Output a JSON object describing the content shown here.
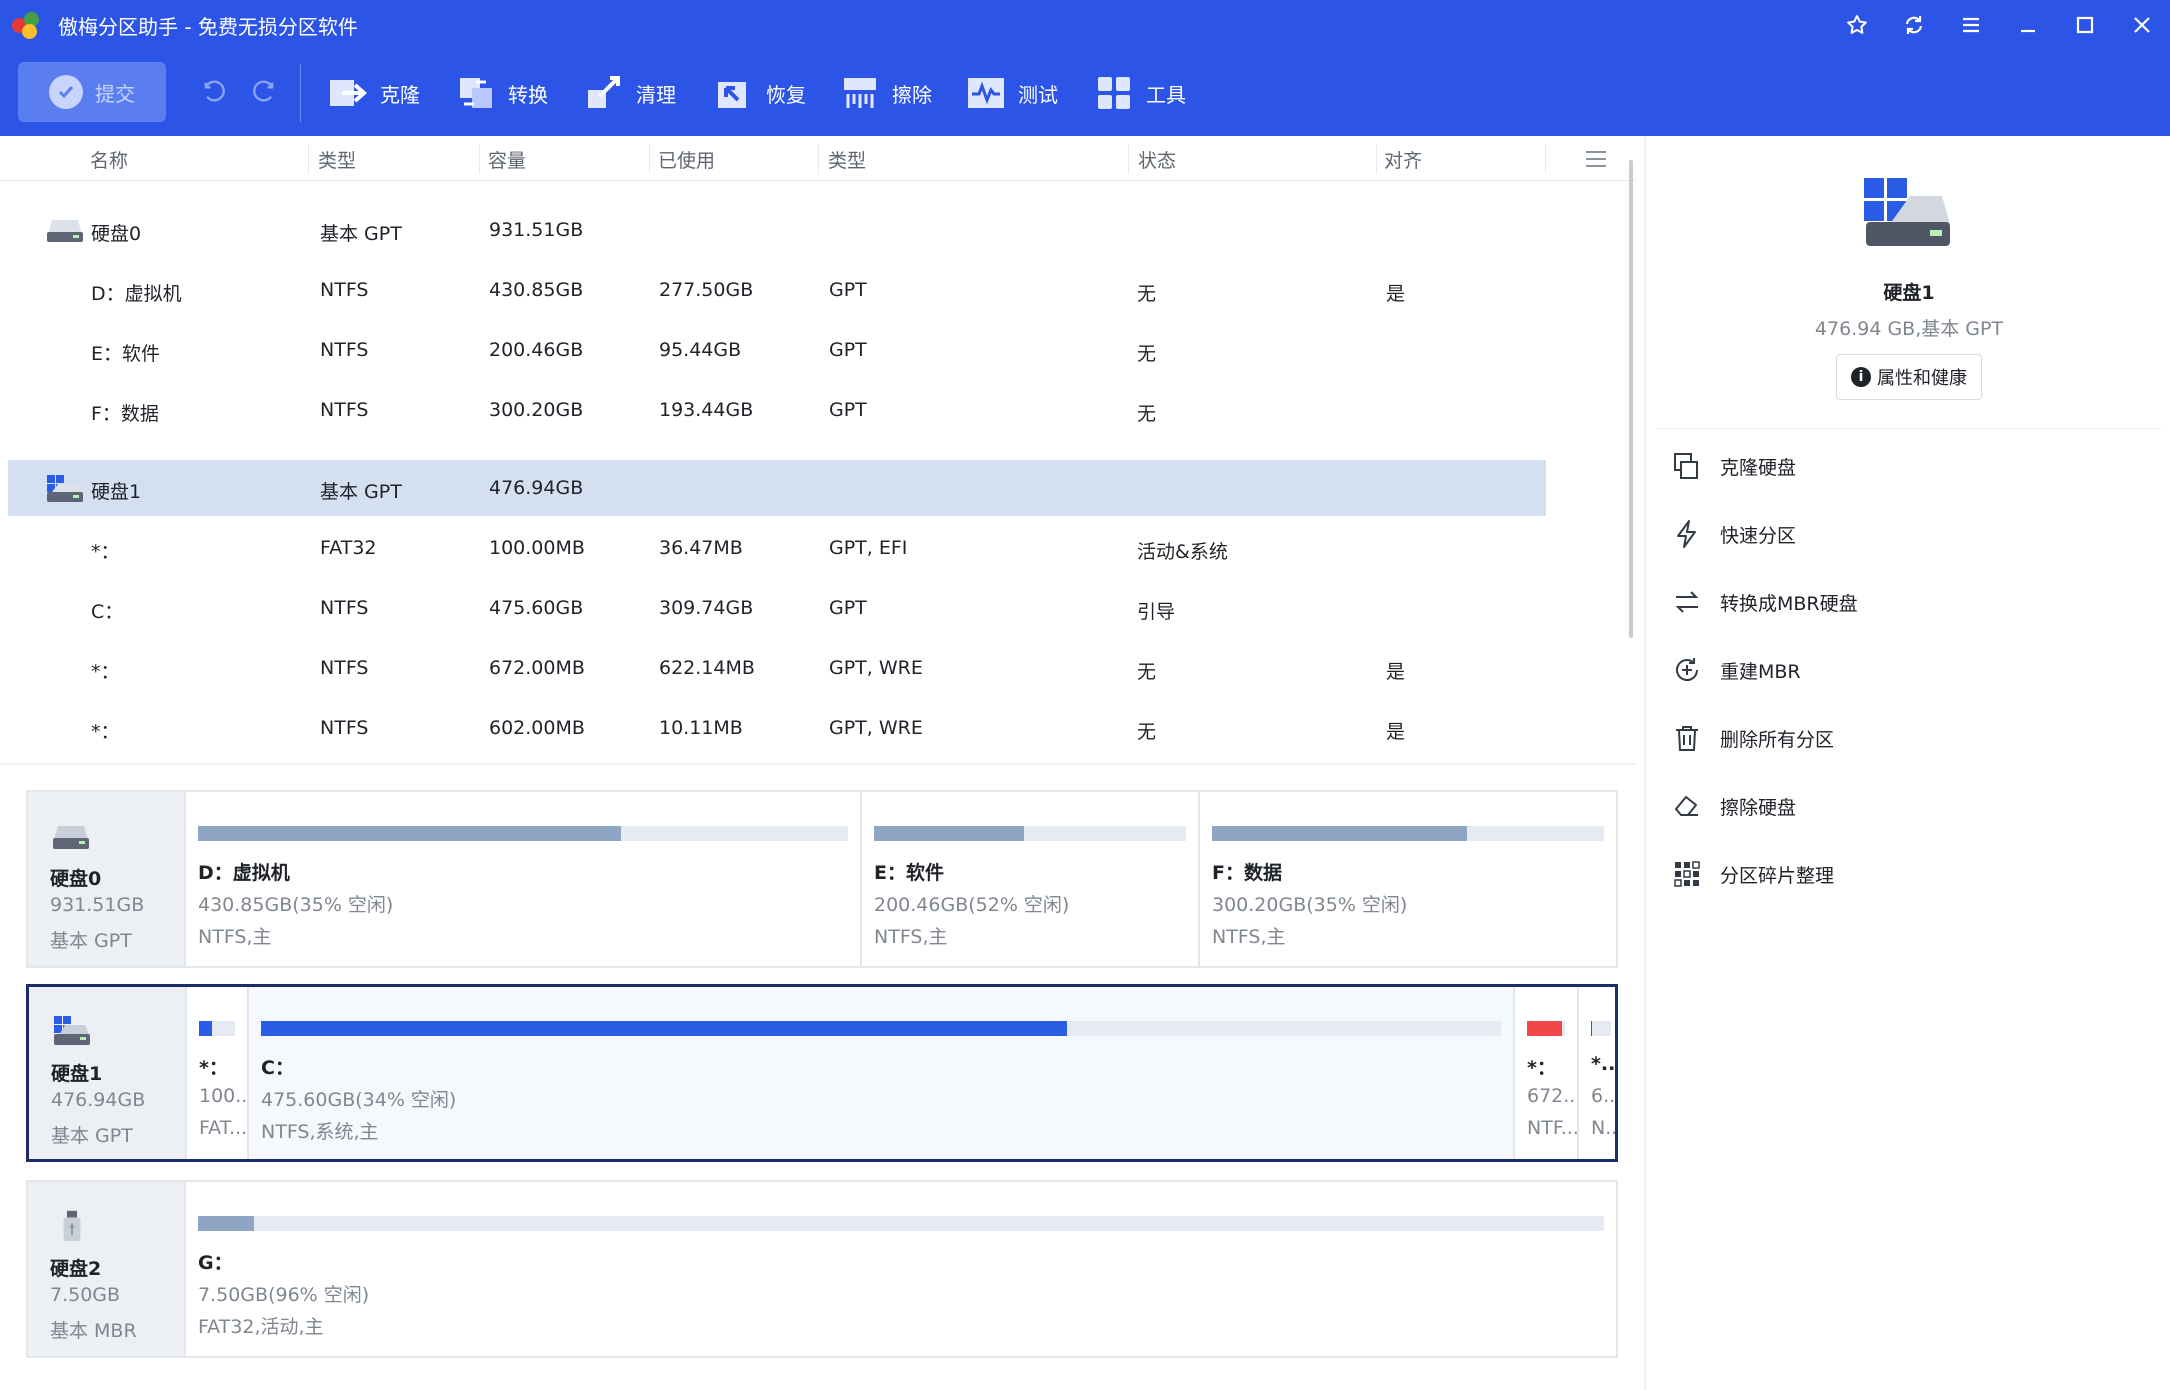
{
  "app": {
    "title": "傲梅分区助手 - 免费无损分区软件"
  },
  "toolbar": {
    "commit_label": "提交",
    "tools": [
      {
        "label": "克隆",
        "icon": "clone-icon"
      },
      {
        "label": "转换",
        "icon": "convert-icon"
      },
      {
        "label": "清理",
        "icon": "cleanup-icon"
      },
      {
        "label": "恢复",
        "icon": "recover-icon"
      },
      {
        "label": "擦除",
        "icon": "wipe-icon"
      },
      {
        "label": "测试",
        "icon": "test-icon"
      },
      {
        "label": "工具",
        "icon": "tools-icon"
      }
    ]
  },
  "table": {
    "columns": [
      "名称",
      "类型",
      "容量",
      "已使用",
      "类型",
      "状态",
      "对齐"
    ],
    "rows": [
      {
        "name": "硬盘0",
        "type": "基本 GPT",
        "capacity": "931.51GB",
        "used": "",
        "ptype": "",
        "status": "",
        "align": "",
        "is_disk": true
      },
      {
        "name": "D：虚拟机",
        "type": "NTFS",
        "capacity": "430.85GB",
        "used": "277.50GB",
        "ptype": "GPT",
        "status": "无",
        "align": "是"
      },
      {
        "name": "E：软件",
        "type": "NTFS",
        "capacity": "200.46GB",
        "used": "95.44GB",
        "ptype": "GPT",
        "status": "无",
        "align": ""
      },
      {
        "name": "F：数据",
        "type": "NTFS",
        "capacity": "300.20GB",
        "used": "193.44GB",
        "ptype": "GPT",
        "status": "无",
        "align": ""
      },
      {
        "name": "硬盘1",
        "type": "基本 GPT",
        "capacity": "476.94GB",
        "used": "",
        "ptype": "",
        "status": "",
        "align": "",
        "is_disk": true,
        "selected": true
      },
      {
        "name": "*：",
        "type": "FAT32",
        "capacity": "100.00MB",
        "used": "36.47MB",
        "ptype": "GPT, EFI",
        "status": "活动&系统",
        "align": ""
      },
      {
        "name": "C：",
        "type": "NTFS",
        "capacity": "475.60GB",
        "used": "309.74GB",
        "ptype": "GPT",
        "status": "引导",
        "align": ""
      },
      {
        "name": "*：",
        "type": "NTFS",
        "capacity": "672.00MB",
        "used": "622.14MB",
        "ptype": "GPT, WRE",
        "status": "无",
        "align": "是"
      },
      {
        "name": "*：",
        "type": "NTFS",
        "capacity": "602.00MB",
        "used": "10.11MB",
        "ptype": "GPT, WRE",
        "status": "无",
        "align": "是"
      }
    ]
  },
  "disks": [
    {
      "name": "硬盘0",
      "size": "931.51GB",
      "type": "基本 GPT",
      "partitions": [
        {
          "name": "D：虚拟机",
          "size": "430.85GB(35% 空闲)",
          "fs": "NTFS,主",
          "used_pct": 65,
          "color": "#8fa5c4"
        },
        {
          "name": "E：软件",
          "size": "200.46GB(52% 空闲)",
          "fs": "NTFS,主",
          "used_pct": 48,
          "color": "#8fa5c4"
        },
        {
          "name": "F：数据",
          "size": "300.20GB(35% 空闲)",
          "fs": "NTFS,主",
          "used_pct": 65,
          "color": "#8fa5c4"
        }
      ]
    },
    {
      "name": "硬盘1",
      "size": "476.94GB",
      "type": "基本 GPT",
      "partitions": [
        {
          "name": "*：",
          "size": "100...",
          "fs": "FAT...",
          "used_pct": 36,
          "color": "#2b5ce6"
        },
        {
          "name": "C：",
          "size": "475.60GB(34% 空闲)",
          "fs": "NTFS,系统,主",
          "used_pct": 65,
          "color": "#2b5ce6"
        },
        {
          "name": "*：",
          "size": "672....",
          "fs": "NTF...",
          "used_pct": 93,
          "color": "#f04848"
        },
        {
          "name": "*...",
          "size": "6...",
          "fs": "N...",
          "used_pct": 2,
          "color": "#2b5ce6"
        }
      ]
    },
    {
      "name": "硬盘2",
      "size": "7.50GB",
      "type": "基本 MBR",
      "partitions": [
        {
          "name": "G：",
          "size": "7.50GB(96% 空闲)",
          "fs": "FAT32,活动,主",
          "used_pct": 4,
          "color": "#8fa5c4"
        }
      ]
    }
  ],
  "right_panel": {
    "disk_name": "硬盘1",
    "disk_info": "476.94 GB,基本 GPT",
    "prop_button": "属性和健康",
    "actions": [
      {
        "label": "克隆硬盘",
        "icon": "clone-disk-icon"
      },
      {
        "label": "快速分区",
        "icon": "quick-partition-icon"
      },
      {
        "label": "转换成MBR硬盘",
        "icon": "convert-mbr-icon"
      },
      {
        "label": "重建MBR",
        "icon": "rebuild-mbr-icon"
      },
      {
        "label": "删除所有分区",
        "icon": "delete-all-icon"
      },
      {
        "label": "擦除硬盘",
        "icon": "wipe-disk-icon"
      },
      {
        "label": "分区碎片整理",
        "icon": "defrag-icon"
      }
    ]
  },
  "colors": {
    "brand": "#2c55e8",
    "selected_row": "#d4dff0",
    "used_bar": "#2b5ce6",
    "used_bar_gray": "#8fa5c4",
    "alert": "#f04848"
  }
}
